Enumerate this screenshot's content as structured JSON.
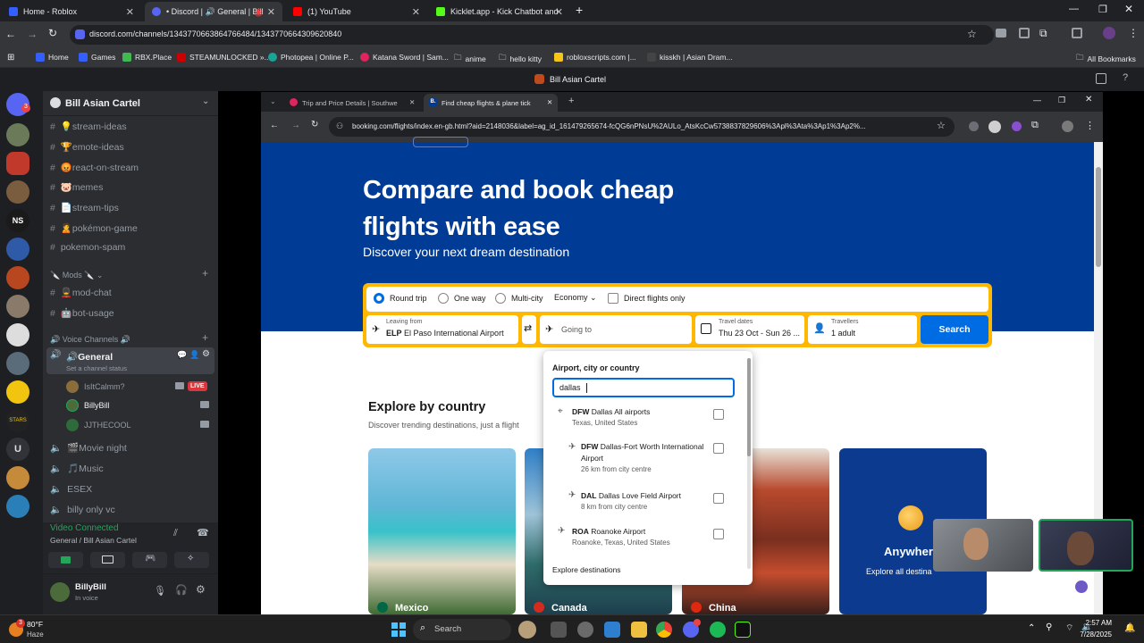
{
  "browser": {
    "tabs": [
      {
        "title": "Home - Roblox",
        "color": "#335fff"
      },
      {
        "title": "• Discord | 🔊 General | Bill",
        "color": "#5865f2"
      },
      {
        "title": "(1) YouTube",
        "color": "#ff0000"
      },
      {
        "title": "Kicklet.app - Kick Chatbot and",
        "color": "#53fc18"
      }
    ],
    "url": "discord.com/channels/1343770663864766484/1343770664309620840",
    "bookmarks": [
      "Home",
      "Games",
      "RBX.Place",
      "STEAMUNLOCKED »...",
      "Photopea | Online P...",
      "Katana Sword | Sam...",
      "anime",
      "hello kitty",
      "robloxscripts.com |...",
      "kisskh | Asian Dram..."
    ],
    "all_bookmarks": "All Bookmarks"
  },
  "discord": {
    "window_title": "Bill Asian Cartel",
    "server_name": "Bill Asian Cartel",
    "channels": [
      {
        "emoji": "💡",
        "name": "stream-ideas"
      },
      {
        "emoji": "🏆",
        "name": "emote-ideas"
      },
      {
        "emoji": "😡",
        "name": "react-on-stream"
      },
      {
        "emoji": "🐷",
        "name": "memes"
      },
      {
        "emoji": "📄",
        "name": "stream-tips"
      },
      {
        "emoji": "🙎",
        "name": "pokémon-game"
      },
      {
        "emoji": "",
        "name": "pokemon-spam"
      }
    ],
    "mods_category": "🔪 Mods 🔪",
    "mod_channels": [
      {
        "emoji": "💂",
        "name": "mod-chat"
      },
      {
        "emoji": "🤖",
        "name": "bot-usage"
      }
    ],
    "voice_category": "🔊 Voice Channels 🔊",
    "general_voice": "🔊General",
    "set_status": "Set a channel status",
    "voice_users": [
      {
        "name": "IsItCalmm?",
        "live": "LIVE"
      },
      {
        "name": "BillyBill",
        "live": ""
      },
      {
        "name": "JJTHECOOL",
        "live": ""
      }
    ],
    "other_voice": [
      "🎬Movie night",
      "🎵Music",
      "ESEX",
      "billy only vc"
    ],
    "video_connected": "Video Connected",
    "connected_to": "General / Bill Asian Cartel",
    "user_name": "BillyBill",
    "user_status": "In voice"
  },
  "shared_screen": {
    "tabs": [
      "Trip and Price Details | Southwe",
      "Find cheap flights & plane tick"
    ],
    "url": "booking.com/flights/index.en-gb.html?aid=2148036&label=ag_id_161479265674-fcQG6nPNsU%2AULo_AtsKcCw573883782960​6%3Apl%3Ata%3Ap1%3Ap2%...",
    "hero_title_1": "Compare and book cheap",
    "hero_title_2": "flights with ease",
    "hero_subtitle": "Discover your next dream destination",
    "trip_types": [
      "Round trip",
      "One way",
      "Multi-city"
    ],
    "cabin": "Economy",
    "direct_only": "Direct flights only",
    "leaving_label": "Leaving from",
    "leaving_code": "ELP",
    "leaving_value": "El Paso International Airport",
    "going_placeholder": "Going to",
    "dates_label": "Travel dates",
    "dates_value": "Thu 23 Oct - Sun 26 ...",
    "travellers_label": "Travellers",
    "travellers_value": "1 adult",
    "search_button": "Search",
    "dropdown_title": "Airport, city or country",
    "dropdown_input": "dallas",
    "options": [
      {
        "code": "DFW",
        "name": "Dallas All airports",
        "sub": "Texas, United States"
      },
      {
        "code": "DFW",
        "name": "Dallas-Fort Worth International",
        "name2": "Airport",
        "sub": "26 km from city centre"
      },
      {
        "code": "DAL",
        "name": "Dallas Love Field Airport",
        "sub": "8 km from city centre"
      },
      {
        "code": "ROA",
        "name": "Roanoke Airport",
        "sub": "Roanoke, Texas, United States"
      }
    ],
    "explore_destinations": "Explore destinations",
    "explore_title": "Explore by country",
    "explore_sub": "Discover trending destinations, just a flight",
    "cards": [
      "Mexico",
      "Canada",
      "China"
    ],
    "anywhere_title": "Anywhere",
    "anywhere_sub": "Explore all destina"
  },
  "taskbar": {
    "weather_temp": "80°F",
    "weather_desc": "Haze",
    "notif_count": "3",
    "search": "Search",
    "time": "2:57 AM",
    "date": "7/28/2025"
  },
  "colors": {
    "booking_blue": "#003b95",
    "booking_yellow": "#ffb700",
    "search_button": "#006ce4",
    "discord_green": "#23a55a",
    "live_red": "#da373c"
  }
}
